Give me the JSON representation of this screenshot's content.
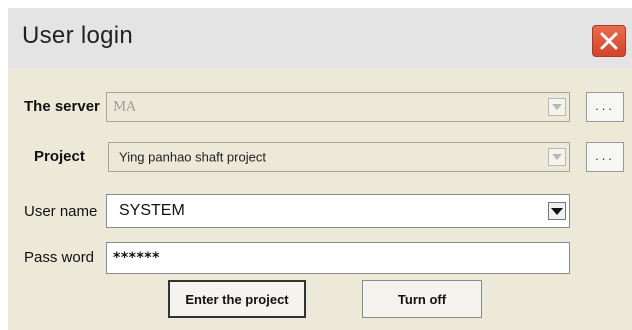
{
  "dialog": {
    "title": "User login",
    "close_icon": "close-x-icon"
  },
  "server": {
    "label": "The server",
    "value": "MA",
    "browse_label": "...",
    "disabled": true
  },
  "project": {
    "label": "Project",
    "value": "Ying panhao shaft project",
    "browse_label": "...",
    "disabled": true
  },
  "username": {
    "label": "User name",
    "value": "SYSTEM"
  },
  "password": {
    "label": "Pass word",
    "value": "******"
  },
  "buttons": {
    "enter_label": "Enter the project",
    "turnoff_label": "Turn off"
  },
  "colors": {
    "dialog_bg": "#ece9d8",
    "titlebar_bg": "#e4e4e4",
    "close_bg": "#d9532f"
  }
}
